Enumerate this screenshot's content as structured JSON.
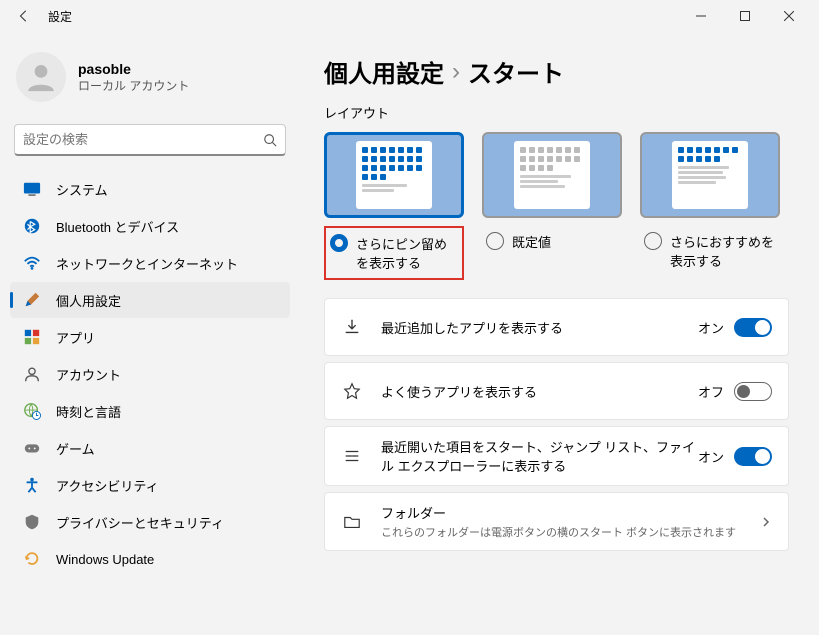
{
  "titlebar": {
    "title": "設定"
  },
  "profile": {
    "name": "pasoble",
    "type": "ローカル アカウント"
  },
  "search": {
    "placeholder": "設定の検索"
  },
  "nav": {
    "items": [
      {
        "label": "システム"
      },
      {
        "label": "Bluetooth とデバイス"
      },
      {
        "label": "ネットワークとインターネット"
      },
      {
        "label": "個人用設定"
      },
      {
        "label": "アプリ"
      },
      {
        "label": "アカウント"
      },
      {
        "label": "時刻と言語"
      },
      {
        "label": "ゲーム"
      },
      {
        "label": "アクセシビリティ"
      },
      {
        "label": "プライバシーとセキュリティ"
      },
      {
        "label": "Windows Update"
      }
    ]
  },
  "breadcrumb": {
    "parent": "個人用設定",
    "sep": "›",
    "current": "スタート"
  },
  "layout": {
    "title": "レイアウト",
    "options": [
      {
        "label": "さらにピン留めを表示する",
        "selected": true
      },
      {
        "label": "既定値",
        "selected": false
      },
      {
        "label": "さらにおすすめを表示する",
        "selected": false
      }
    ]
  },
  "settings": [
    {
      "label": "最近追加したアプリを表示する",
      "state": "オン",
      "on": true
    },
    {
      "label": "よく使うアプリを表示する",
      "state": "オフ",
      "on": false
    },
    {
      "label": "最近開いた項目をスタート、ジャンプ リスト、ファイル エクスプローラーに表示する",
      "state": "オン",
      "on": true
    }
  ],
  "folders": {
    "label": "フォルダー",
    "desc": "これらのフォルダーは電源ボタンの横のスタート ボタンに表示されます"
  }
}
